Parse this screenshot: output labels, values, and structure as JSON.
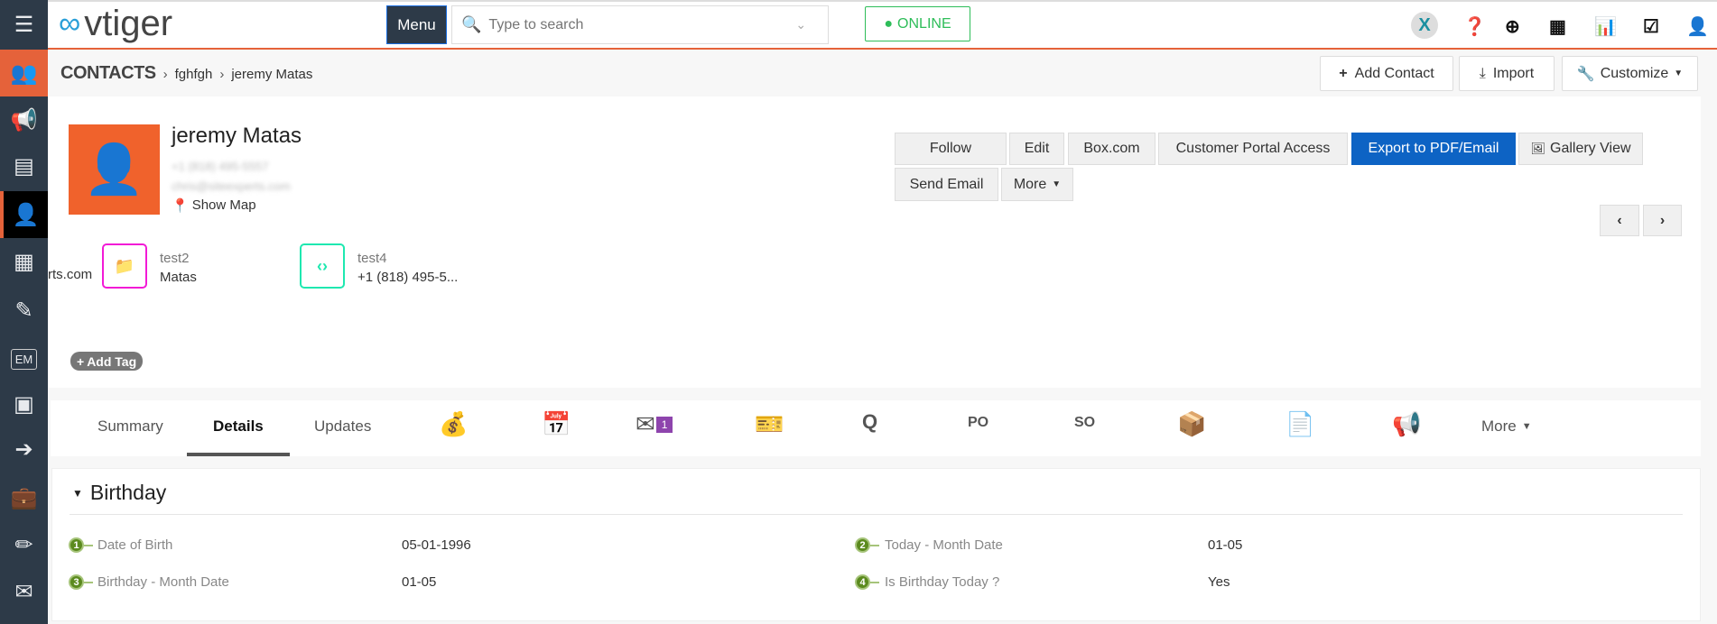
{
  "app": {
    "logo": "vtiger",
    "menu_label": "Menu",
    "search_placeholder": "Type to search",
    "online_label": "ONLINE",
    "accent": "#e5623a",
    "primary": "#0d63c4"
  },
  "top_icons": [
    "x-logo-icon",
    "help-icon",
    "plus-circle-icon",
    "calendar-icon",
    "chart-icon",
    "check-square-icon",
    "user-icon"
  ],
  "sidebar": {
    "items": [
      "menu-icon",
      "contacts-icon",
      "campaigns-icon",
      "leads-icon",
      "contact-icon",
      "organizations-icon",
      "documents-icon",
      "EM",
      "address-book-icon",
      "export-icon",
      "briefcase-icon",
      "pencil-icon",
      "email-settings-icon"
    ]
  },
  "breadcrumb": {
    "module": "CONTACTS",
    "list": "fghfgh",
    "record": "jeremy Matas"
  },
  "header_buttons": {
    "add": "Add Contact",
    "import": "Import",
    "customize": "Customize"
  },
  "record": {
    "name": "jeremy Matas",
    "phone": "+1 (818) 495-5557",
    "email": "chris@siteexperts.com",
    "show_map": "Show Map",
    "partial_field": "rts.com",
    "key_fields": [
      {
        "label": "test2",
        "value": "Matas",
        "color": "#f21ad6"
      },
      {
        "label": "test4",
        "value": "+1 (818) 495-5...",
        "color": "#1ee8b0"
      }
    ],
    "add_tag": "Add Tag"
  },
  "actions": {
    "follow": "Follow",
    "edit": "Edit",
    "box": "Box.com",
    "portal": "Customer Portal Access",
    "export": "Export to PDF/Email",
    "gallery": "Gallery View",
    "send_email": "Send Email",
    "more": "More"
  },
  "tabs": {
    "summary": "Summary",
    "details": "Details",
    "updates": "Updates",
    "mail_badge": "1",
    "more": "More",
    "active": "Details"
  },
  "block": {
    "title": "Birthday",
    "fields": [
      {
        "num": "1",
        "label": "Date of Birth",
        "value": "05-01-1996"
      },
      {
        "num": "2",
        "label": "Today - Month Date",
        "value": "01-05"
      },
      {
        "num": "3",
        "label": "Birthday - Month Date",
        "value": "01-05"
      },
      {
        "num": "4",
        "label": "Is Birthday Today ?",
        "value": "Yes"
      }
    ]
  }
}
